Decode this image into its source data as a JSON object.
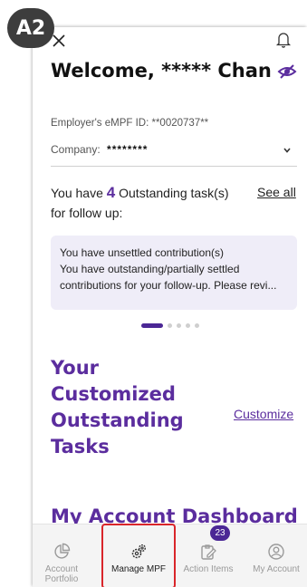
{
  "step_badge": "A2",
  "header": {
    "welcome": "Welcome, ***** Chan"
  },
  "employer": {
    "eid_text": "Employer's eMPF ID: **0020737**",
    "company_label": "Company:",
    "company_value": "********"
  },
  "tasks": {
    "prefix": "You have",
    "count": "4",
    "suffix": "Outstanding task(s)",
    "line2": "for follow up:",
    "see_all": "See all"
  },
  "card": {
    "line1": "You have unsettled contribution(s)",
    "line2": "You have outstanding/partially settled",
    "line3": "contributions for your follow-up. Please revi..."
  },
  "carousel": {
    "total": 5,
    "active": 0
  },
  "customized": {
    "title_l1": "Your",
    "title_l2": "Customized",
    "title_l3": "Outstanding",
    "title_l4": "Tasks",
    "customize_link": "Customize"
  },
  "dashboard": {
    "title": "My Account Dashboard"
  },
  "tabs": {
    "account_portfolio": "Account Portfolio",
    "manage_mpf": "Manage MPF",
    "action_items": "Action Items",
    "action_items_badge": "23",
    "my_account": "My Account"
  },
  "colors": {
    "brand_purple": "#5b2d9e",
    "highlight_red": "#d9252a",
    "card_bg": "#efedf8"
  }
}
